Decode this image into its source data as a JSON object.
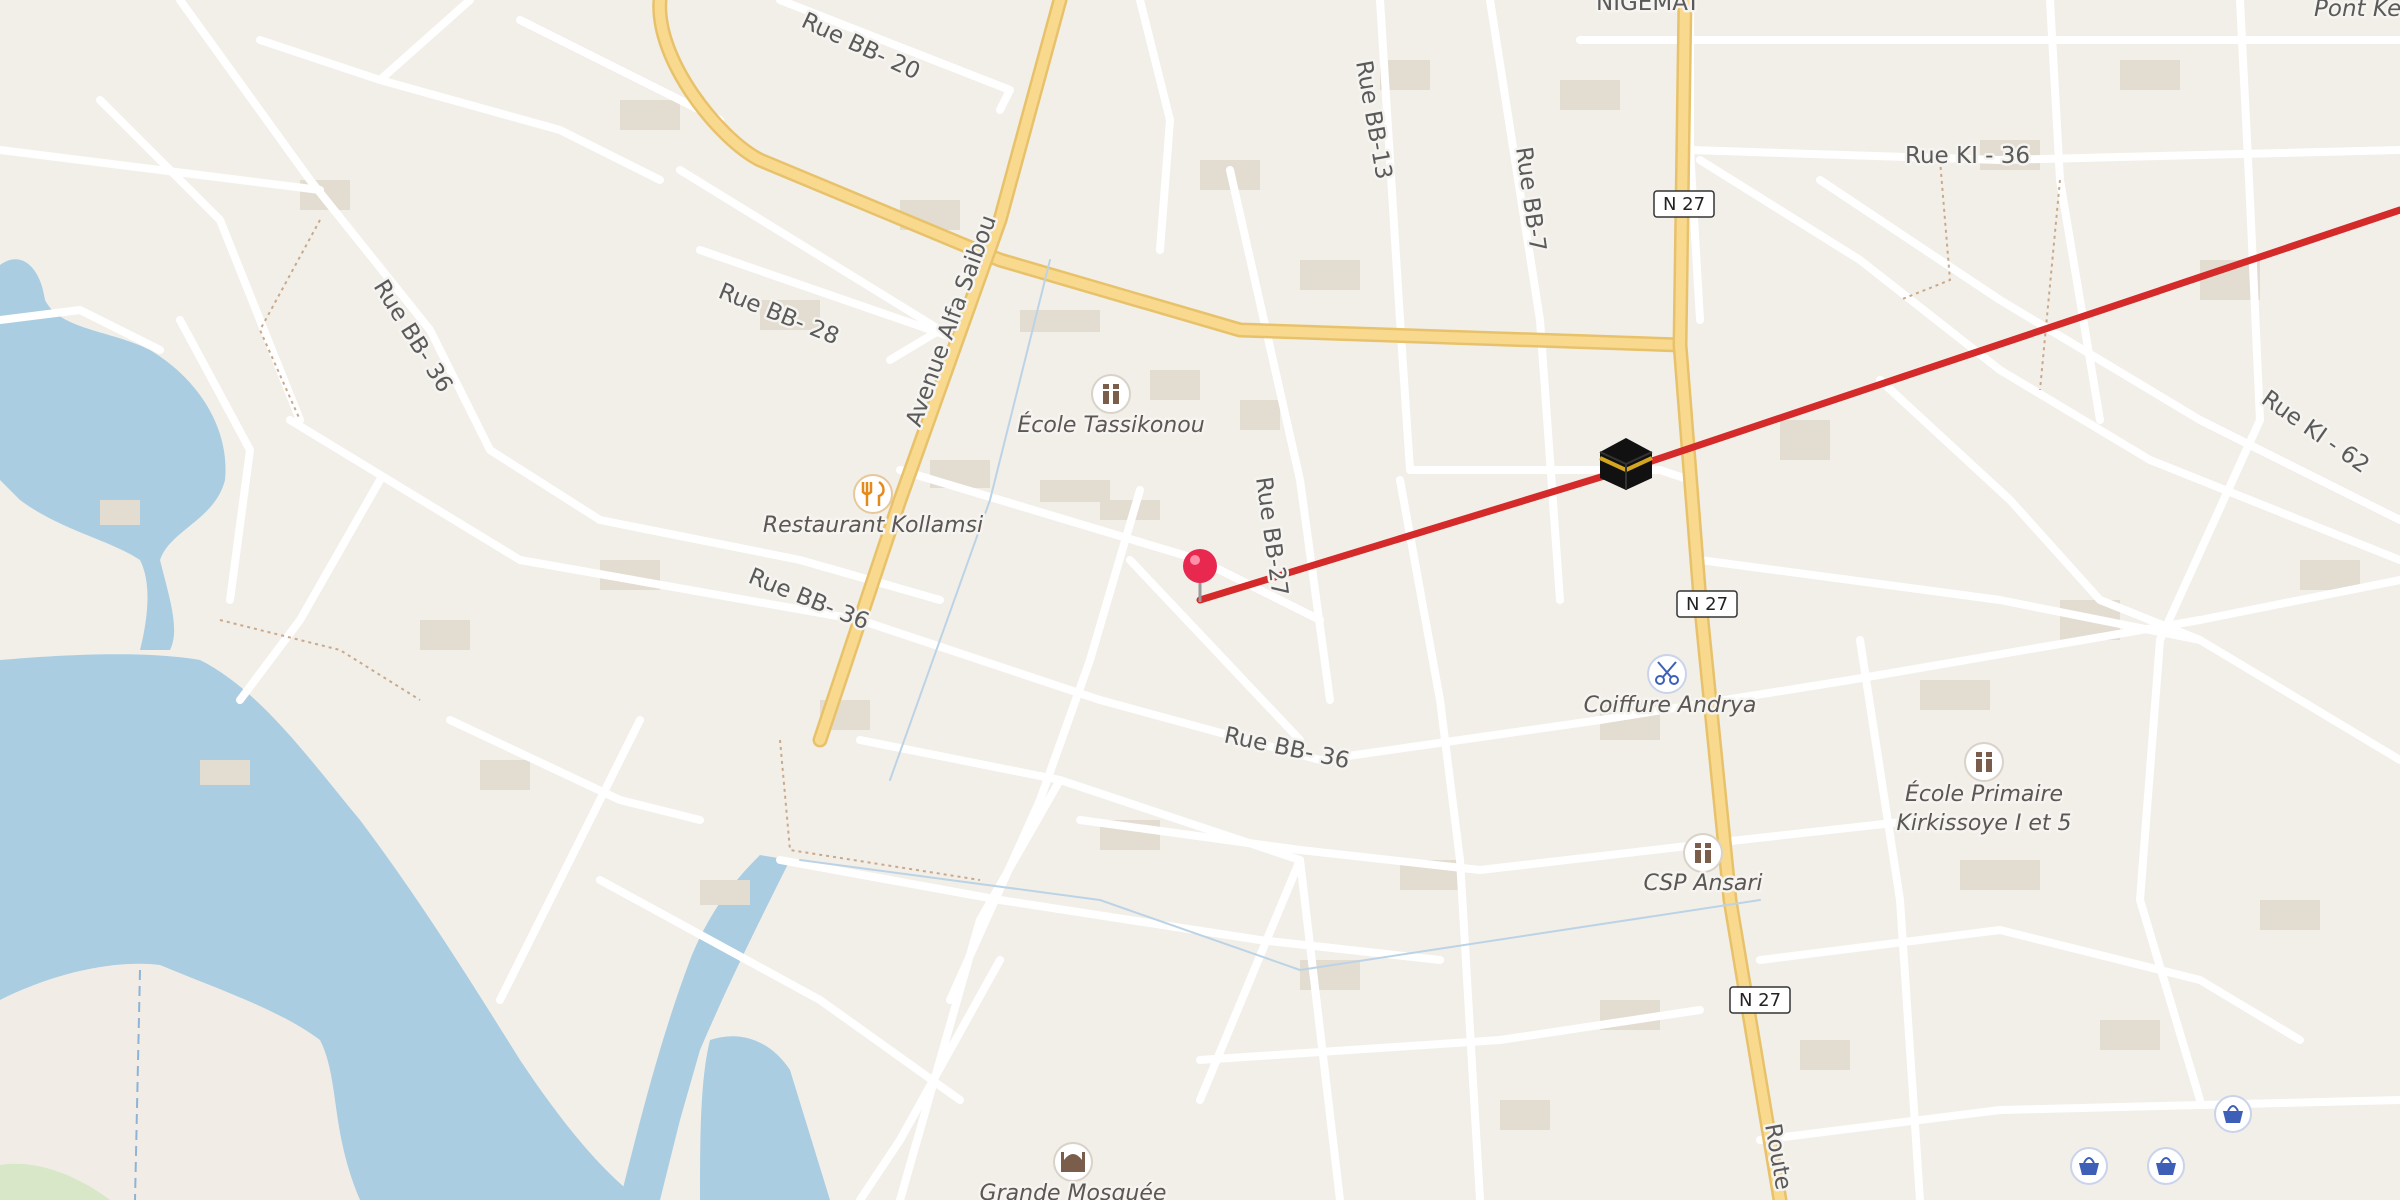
{
  "map": {
    "colors": {
      "land": "#f2efe9",
      "water": "#aacde2",
      "sand": "#f1ede6",
      "minor_road": "#ffffff",
      "primary_road": "#f8d98e",
      "primary_road_casing": "#e8c26b",
      "building": "#e3dcd1",
      "route_line": "#d42a2a",
      "pin": "#e8284f"
    },
    "streets": [
      {
        "name": "Rue BB- 20"
      },
      {
        "name": "Avenue Alfa Saibou"
      },
      {
        "name": "Rue BB-13"
      },
      {
        "name": "Rue BB-7"
      },
      {
        "name": "Rue KI - 36"
      },
      {
        "name": "Rue BB- 28"
      },
      {
        "name": "Rue BB- 36"
      },
      {
        "name": "Rue BB-27"
      },
      {
        "name": "Rue BB- 36"
      },
      {
        "name": "Rue BB- 36"
      },
      {
        "name": "Rue KI - 62"
      },
      {
        "name": "NIGEMAT"
      },
      {
        "name": "Pont Ke"
      },
      {
        "name": "Route"
      }
    ],
    "route_shields": [
      "N 27",
      "N 27",
      "N 27"
    ],
    "pois": [
      {
        "name": "École Tassikonou",
        "icon": "school-icon"
      },
      {
        "name": "Restaurant Kollamsi",
        "icon": "restaurant-icon"
      },
      {
        "name": "Coiffure Andrya",
        "icon": "hairdresser-icon"
      },
      {
        "name": "École Primaire",
        "name2": "Kirkissoye I et 5",
        "icon": "school-icon"
      },
      {
        "name": "CSP Ansari",
        "icon": "school-icon"
      },
      {
        "name": "Grande Mosquée",
        "icon": "mosque-icon"
      }
    ],
    "markers": {
      "pin": "location-pin-icon",
      "destination": "kaaba-icon",
      "shops": [
        "shop-icon",
        "shop-icon",
        "shop-icon"
      ]
    }
  }
}
